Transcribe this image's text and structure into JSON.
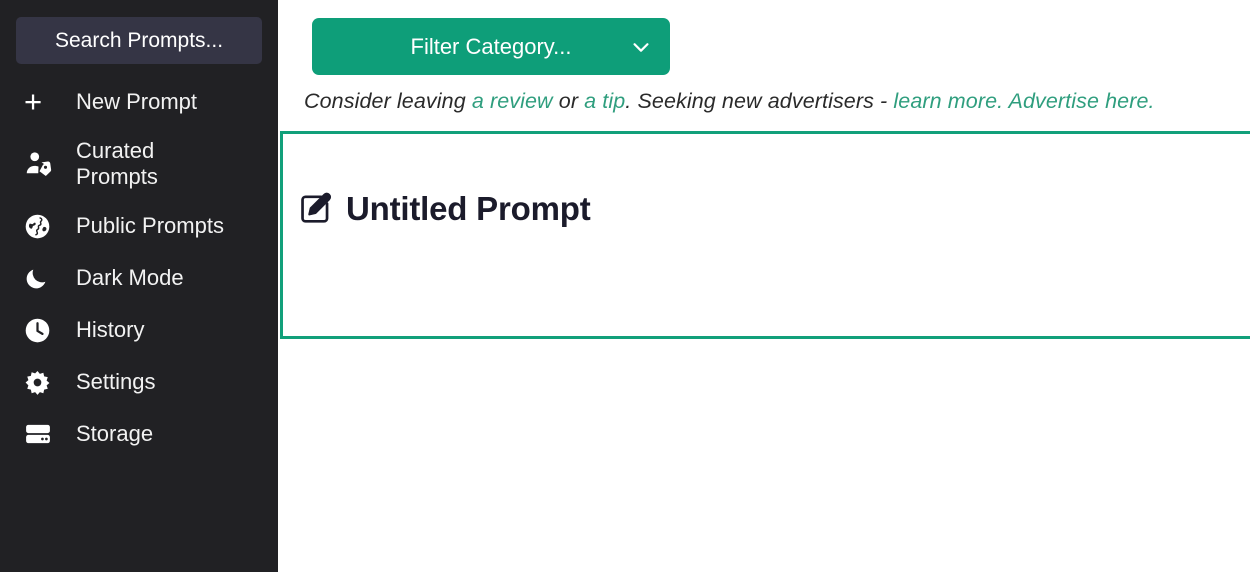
{
  "sidebar": {
    "search": {
      "name": "search-prompts-input",
      "value": "",
      "placeholder": "Search Prompts..."
    },
    "items": [
      {
        "label": "New Prompt",
        "icon": "plus-icon",
        "key": "new-prompt"
      },
      {
        "label": "Curated\nPrompts",
        "icon": "user-tag-icon",
        "key": "curated-prompts"
      },
      {
        "label": "Public Prompts",
        "icon": "globe-icon",
        "key": "public-prompts"
      },
      {
        "label": "Dark Mode",
        "icon": "moon-icon",
        "key": "dark-mode"
      },
      {
        "label": "History",
        "icon": "clock-icon",
        "key": "history"
      },
      {
        "label": "Settings",
        "icon": "gear-icon",
        "key": "settings"
      },
      {
        "label": "Storage",
        "icon": "server-icon",
        "key": "storage"
      }
    ]
  },
  "main": {
    "filter": {
      "label": "Filter Category...",
      "chevron_icon": "chevron-down-icon"
    },
    "ad": {
      "seg1": "Consider leaving ",
      "link1": "a review",
      "seg2": " or ",
      "link2": "a tip",
      "seg3": ". Seeking new advertisers - ",
      "link3": "learn more.",
      "seg4": "  ",
      "link4": "Advertise here."
    },
    "prompt_card": {
      "ghost_text": "",
      "edit_icon": "edit-square-pencil-icon",
      "title": "Untitled Prompt"
    }
  },
  "colors": {
    "sidebar_bg": "#212124",
    "search_bg": "#353545",
    "accent_green": "#0e9e79",
    "card_border": "#11a07a",
    "link_green": "#2f9e7e",
    "text_dark": "#1b1b2b",
    "page_bg": "#ffffff"
  }
}
